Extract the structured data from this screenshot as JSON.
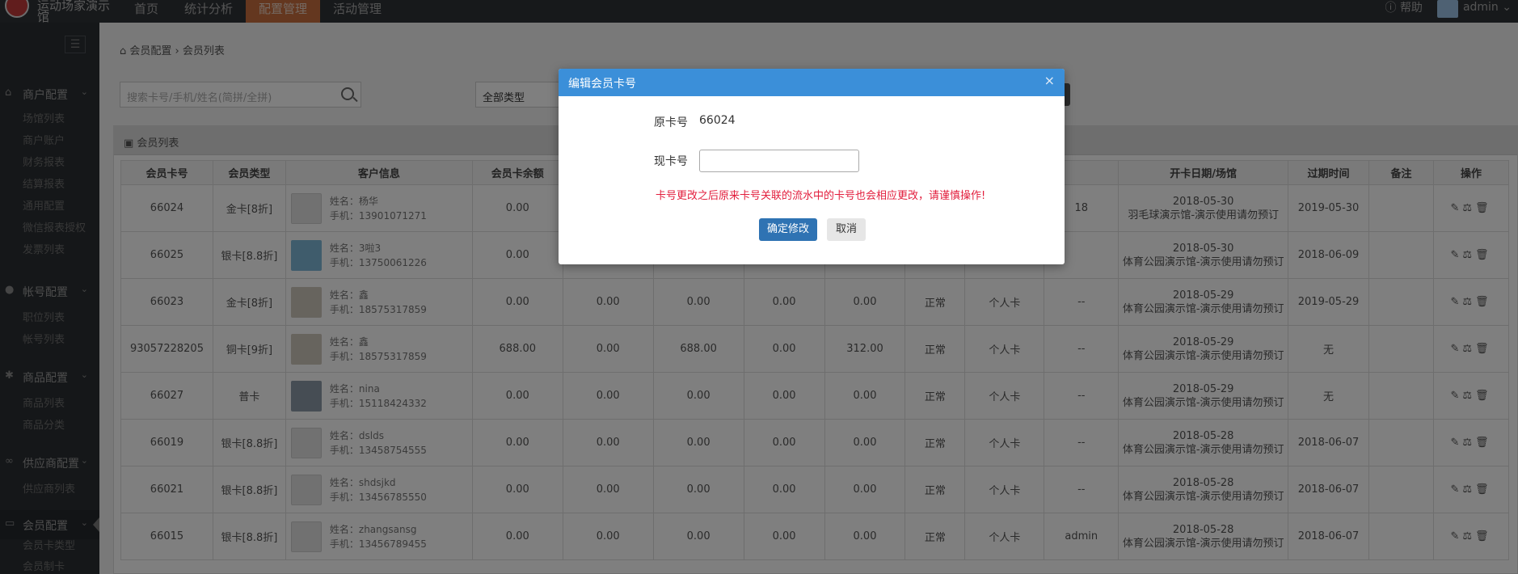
{
  "app": {
    "logo_text": "运动场家演示馆"
  },
  "topnav": [
    {
      "label": "首页"
    },
    {
      "label": "统计分析"
    },
    {
      "label": "配置管理",
      "active": true
    },
    {
      "label": "活动管理"
    }
  ],
  "topright": {
    "help": "帮助",
    "user": "admin"
  },
  "sidebar": {
    "sections": [
      {
        "label": "商户配置",
        "items": [
          "场馆列表",
          "商户账户",
          "财务报表",
          "结算报表",
          "通用配置",
          "微信报表授权",
          "发票列表"
        ]
      },
      {
        "label": "帐号配置",
        "items": [
          "职位列表",
          "帐号列表"
        ]
      },
      {
        "label": "商品配置",
        "items": [
          "商品列表",
          "商品分类"
        ]
      },
      {
        "label": "供应商配置",
        "items": [
          "供应商列表"
        ]
      },
      {
        "label": "会员配置",
        "items": [
          "会员卡类型",
          "会员制卡"
        ]
      }
    ]
  },
  "breadcrumb": {
    "home": "会员配置",
    "current": "会员列表"
  },
  "filters": {
    "search_placeholder": "搜索卡号/手机/姓名(简拼/全拼)",
    "type_select": "全部类型"
  },
  "panel": {
    "title": "会员列表"
  },
  "table": {
    "headers": [
      "会员卡号",
      "会员类型",
      "客户信息",
      "会员卡余额",
      "",
      "",
      "",
      "",
      "",
      "",
      "",
      "开卡日期/场馆",
      "过期时间",
      "备注",
      "操作"
    ],
    "rows": [
      {
        "card": "66024",
        "type": "金卡[8折]",
        "name": "姓名：杨华",
        "phone": "手机：13901071271",
        "balance": "0.00",
        "c5": "",
        "c6": "",
        "c7": "",
        "c8": "",
        "c9": "",
        "c10": "",
        "c11": "18",
        "date": "2018-05-30",
        "venue": "羽毛球演示馆-演示使用请勿预订",
        "expire": "2019-05-30"
      },
      {
        "card": "66025",
        "type": "银卡[8.8折]",
        "name": "姓名：3啦3",
        "phone": "手机：13750061226",
        "balance": "0.00",
        "c5": "",
        "c6": "",
        "c7": "",
        "c8": "",
        "c9": "",
        "c10": "",
        "c11": "",
        "date": "2018-05-30",
        "venue": "体育公园演示馆-演示使用请勿预订",
        "expire": "2018-06-09"
      },
      {
        "card": "66023",
        "type": "金卡[8折]",
        "name": "姓名：鑫",
        "phone": "手机：18575317859",
        "balance": "0.00",
        "c5": "0.00",
        "c6": "0.00",
        "c7": "0.00",
        "c8": "0.00",
        "c9": "正常",
        "c10": "个人卡",
        "c11": "--",
        "date": "2018-05-29",
        "venue": "体育公园演示馆-演示使用请勿预订",
        "expire": "2019-05-29"
      },
      {
        "card": "93057228205",
        "type": "铜卡[9折]",
        "name": "姓名：鑫",
        "phone": "手机：18575317859",
        "balance": "688.00",
        "c5": "0.00",
        "c6": "688.00",
        "c7": "0.00",
        "c8": "312.00",
        "c9": "正常",
        "c10": "个人卡",
        "c11": "--",
        "date": "2018-05-29",
        "venue": "体育公园演示馆-演示使用请勿预订",
        "expire": "无"
      },
      {
        "card": "66027",
        "type": "普卡",
        "name": "姓名：nina",
        "phone": "手机：15118424332",
        "balance": "0.00",
        "c5": "0.00",
        "c6": "0.00",
        "c7": "0.00",
        "c8": "0.00",
        "c9": "正常",
        "c10": "个人卡",
        "c11": "--",
        "date": "2018-05-29",
        "venue": "体育公园演示馆-演示使用请勿预订",
        "expire": "无"
      },
      {
        "card": "66019",
        "type": "银卡[8.8折]",
        "name": "姓名：dslds",
        "phone": "手机：13458754555",
        "balance": "0.00",
        "c5": "0.00",
        "c6": "0.00",
        "c7": "0.00",
        "c8": "0.00",
        "c9": "正常",
        "c10": "个人卡",
        "c11": "--",
        "date": "2018-05-28",
        "venue": "体育公园演示馆-演示使用请勿预订",
        "expire": "2018-06-07"
      },
      {
        "card": "66021",
        "type": "银卡[8.8折]",
        "name": "姓名：shdsjkd",
        "phone": "手机：13456785550",
        "balance": "0.00",
        "c5": "0.00",
        "c6": "0.00",
        "c7": "0.00",
        "c8": "0.00",
        "c9": "正常",
        "c10": "个人卡",
        "c11": "--",
        "date": "2018-05-28",
        "venue": "体育公园演示馆-演示使用请勿预订",
        "expire": "2018-06-07"
      },
      {
        "card": "66015",
        "type": "银卡[8.8折]",
        "name": "姓名：zhangsansg",
        "phone": "手机：13456789455",
        "balance": "0.00",
        "c5": "0.00",
        "c6": "0.00",
        "c7": "0.00",
        "c8": "0.00",
        "c9": "正常",
        "c10": "个人卡",
        "c11": "admin",
        "date": "2018-05-28",
        "venue": "体育公园演示馆-演示使用请勿预订",
        "expire": "2018-06-07"
      }
    ]
  },
  "modal": {
    "title": "编辑会员卡号",
    "close": "×",
    "orig_label": "原卡号",
    "orig_value": "66024",
    "new_label": "现卡号",
    "new_value": "",
    "warning": "卡号更改之后原来卡号关联的流水中的卡号也会相应更改，请谨慎操作!",
    "confirm": "确定修改",
    "cancel": "取消"
  }
}
